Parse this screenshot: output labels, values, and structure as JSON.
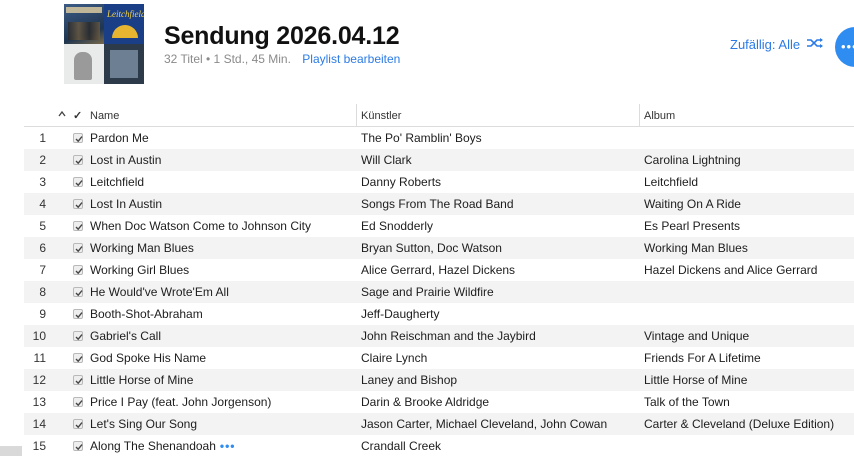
{
  "header": {
    "title": "Sendung 2026.04.12",
    "meta": "32 Titel • 1 Std., 45 Min.",
    "edit_link": "Playlist bearbeiten",
    "shuffle_label": "Zufällig: Alle",
    "more_button": "•••",
    "artwork_text": "Leitchfield"
  },
  "table": {
    "columns": {
      "check": "✓",
      "name": "Name",
      "artist": "Künstler",
      "album": "Album"
    },
    "rows": [
      {
        "num": "1",
        "name": "Pardon Me",
        "artist": "The Po' Ramblin' Boys",
        "album": ""
      },
      {
        "num": "2",
        "name": "Lost in Austin",
        "artist": "Will Clark",
        "album": "Carolina Lightning"
      },
      {
        "num": "3",
        "name": "Leitchfield",
        "artist": "Danny Roberts",
        "album": "Leitchfield"
      },
      {
        "num": "4",
        "name": "Lost In Austin",
        "artist": "Songs From The Road Band",
        "album": "Waiting On A Ride"
      },
      {
        "num": "5",
        "name": "When Doc Watson Come to Johnson City",
        "artist": "Ed Snodderly",
        "album": "Es Pearl Presents"
      },
      {
        "num": "6",
        "name": "Working Man Blues",
        "artist": "Bryan Sutton, Doc Watson",
        "album": "Working Man Blues"
      },
      {
        "num": "7",
        "name": "Working Girl Blues",
        "artist": "Alice Gerrard, Hazel Dickens",
        "album": "Hazel Dickens and Alice Gerrard"
      },
      {
        "num": "8",
        "name": "He Would've Wrote'Em All",
        "artist": "Sage and Prairie Wildfire",
        "album": ""
      },
      {
        "num": "9",
        "name": "Booth-Shot-Abraham",
        "artist": "Jeff-Daugherty",
        "album": ""
      },
      {
        "num": "10",
        "name": "Gabriel's Call",
        "artist": "John Reischman and the Jaybird",
        "album": "Vintage and Unique"
      },
      {
        "num": "11",
        "name": "God Spoke His Name",
        "artist": "Claire Lynch",
        "album": "Friends For A Lifetime"
      },
      {
        "num": "12",
        "name": "Little Horse of Mine",
        "artist": "Laney and Bishop",
        "album": "Little Horse of Mine"
      },
      {
        "num": "13",
        "name": "Price I Pay (feat. John Jorgenson)",
        "artist": "Darin & Brooke Aldridge",
        "album": "Talk of the Town"
      },
      {
        "num": "14",
        "name": "Let's Sing Our Song",
        "artist": "Jason Carter, Michael Cleveland, John Cowan",
        "album": "Carter & Cleveland (Deluxe Edition)"
      },
      {
        "num": "15",
        "name": "Along The Shenandoah",
        "artist": "Crandall Creek",
        "album": "",
        "has_more": true
      }
    ]
  },
  "colors": {
    "accent": "#2c7be5",
    "alt_row": "#f3f3f3"
  }
}
